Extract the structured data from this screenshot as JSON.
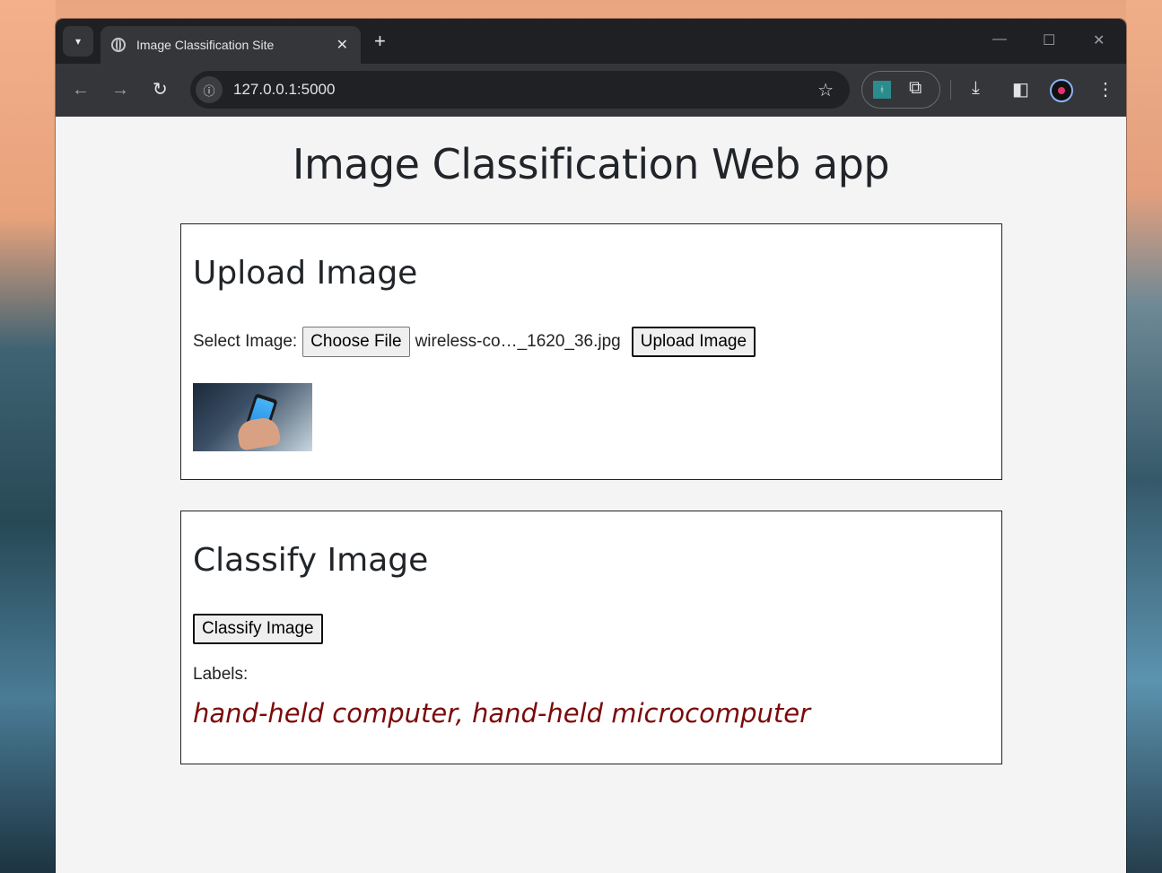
{
  "browser": {
    "tab_title": "Image Classification Site",
    "url": "127.0.0.1:5000"
  },
  "page": {
    "title": "Image Classification Web app",
    "upload": {
      "heading": "Upload Image",
      "select_label": "Select Image:",
      "choose_file_label": "Choose File",
      "file_name": "wireless-co…_1620_36.jpg",
      "upload_button": "Upload Image"
    },
    "classify": {
      "heading": "Classify Image",
      "classify_button": "Classify Image",
      "labels_label": "Labels:",
      "result": "hand-held computer, hand-held microcomputer"
    }
  },
  "icons": {
    "tab_menu": "chevron-down-icon",
    "favicon": "globe-icon",
    "close_tab": "close-icon",
    "new_tab": "plus-icon",
    "back": "arrow-left-icon",
    "forward": "arrow-right-icon",
    "reload": "reload-icon",
    "site_info": "info-icon",
    "bookmark": "star-icon",
    "extensions": "puzzle-icon",
    "downloads": "download-icon",
    "side_panel": "side-panel-icon",
    "menu": "kebab-menu-icon"
  }
}
